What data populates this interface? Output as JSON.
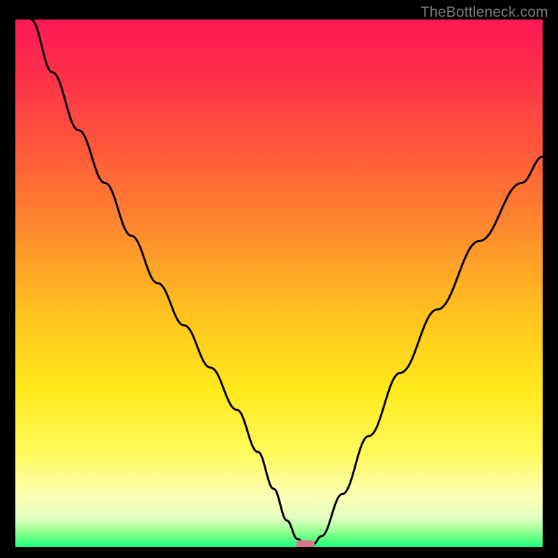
{
  "watermark": "TheBottleneck.com",
  "chart_data": {
    "type": "line",
    "title": "",
    "xlabel": "",
    "ylabel": "",
    "xlim": [
      0,
      100
    ],
    "ylim": [
      0,
      100
    ],
    "grid": false,
    "legend": false,
    "background_gradient": {
      "stops": [
        {
          "offset": 0.0,
          "color": "#ff1a55"
        },
        {
          "offset": 0.1,
          "color": "#ff2e4a"
        },
        {
          "offset": 0.25,
          "color": "#ff5a3a"
        },
        {
          "offset": 0.4,
          "color": "#ff8a2e"
        },
        {
          "offset": 0.55,
          "color": "#ffc01f"
        },
        {
          "offset": 0.7,
          "color": "#ffe81a"
        },
        {
          "offset": 0.82,
          "color": "#fff95a"
        },
        {
          "offset": 0.9,
          "color": "#fdffb0"
        },
        {
          "offset": 0.945,
          "color": "#e3ffc0"
        },
        {
          "offset": 0.965,
          "color": "#a8ff9e"
        },
        {
          "offset": 0.985,
          "color": "#5bff7e"
        },
        {
          "offset": 1.0,
          "color": "#19ff83"
        }
      ]
    },
    "series": [
      {
        "name": "bottleneck-curve",
        "stroke": "#000000",
        "stroke_width": 3,
        "x": [
          3,
          7,
          12,
          17,
          22,
          27,
          32,
          37,
          42,
          46,
          49,
          51.5,
          53.5,
          55,
          56.5,
          58,
          62,
          67,
          73,
          80,
          88,
          96,
          100
        ],
        "y": [
          100,
          90,
          79,
          69,
          59,
          50,
          42,
          34,
          26,
          18,
          11,
          5,
          1.5,
          0.5,
          0.5,
          2,
          10,
          21,
          33,
          45,
          58,
          69,
          74
        ]
      }
    ],
    "marker": {
      "name": "optimal-marker",
      "x": 55,
      "y": 0.5,
      "width": 3.5,
      "height": 1.5,
      "rx": 0.8,
      "fill": "#d9758a"
    }
  }
}
